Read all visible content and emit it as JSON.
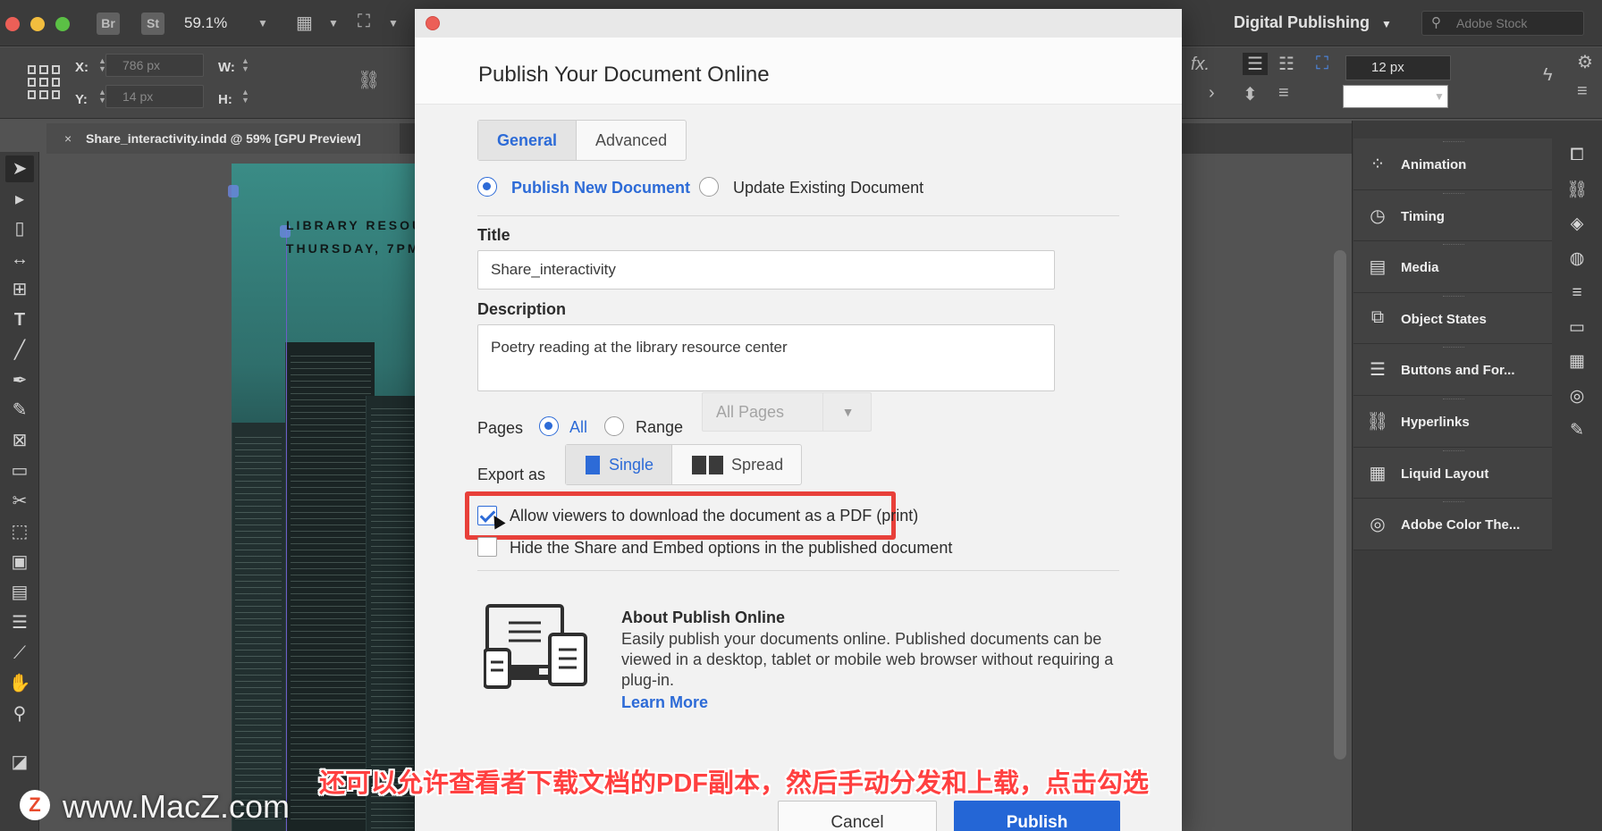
{
  "app": {
    "bridge_label": "Br",
    "stock_label": "St",
    "zoom": "59.1%",
    "workspace": "Digital Publishing",
    "search_placeholder": "Adobe Stock"
  },
  "control_bar": {
    "x_label": "X:",
    "x_value": "786 px",
    "y_label": "Y:",
    "y_value": "14 px",
    "w_label": "W:",
    "h_label": "H:",
    "stroke_weight": "12 px"
  },
  "document_tab": {
    "title": "Share_interactivity.indd @ 59% [GPU Preview]",
    "close": "×"
  },
  "canvas": {
    "line1": "LIBRARY RESOU",
    "line2": "THURSDAY, 7PM"
  },
  "panels": [
    {
      "label": "Animation",
      "icon": "animation-icon",
      "glyph": "⁘"
    },
    {
      "label": "Timing",
      "icon": "timing-icon",
      "glyph": "◷"
    },
    {
      "label": "Media",
      "icon": "media-icon",
      "glyph": "▤"
    },
    {
      "label": "Object States",
      "icon": "object-states-icon",
      "glyph": "⧉"
    },
    {
      "label": "Buttons and For...",
      "icon": "buttons-forms-icon",
      "glyph": "☰"
    },
    {
      "label": "Hyperlinks",
      "icon": "hyperlinks-icon",
      "glyph": "⛓"
    },
    {
      "label": "Liquid Layout",
      "icon": "liquid-layout-icon",
      "glyph": "▦"
    },
    {
      "label": "Adobe Color The...",
      "icon": "adobe-color-themes-icon",
      "glyph": "◎"
    }
  ],
  "dialog": {
    "title": "Publish Your Document Online",
    "tabs": [
      "General",
      "Advanced"
    ],
    "publish_new": "Publish New Document",
    "update_existing": "Update Existing Document",
    "title_label": "Title",
    "title_value": "Share_interactivity",
    "description_label": "Description",
    "description_value": "Poetry reading at the library resource center",
    "pages_label": "Pages",
    "pages_all": "All",
    "pages_range": "Range",
    "pages_dropdown": "All Pages",
    "export_label": "Export as",
    "export_single": "Single",
    "export_spread": "Spread",
    "allow_pdf": "Allow viewers to download the document as a PDF (print)",
    "hide_share": "Hide the Share and Embed options in the published document",
    "about_title": "About Publish Online",
    "about_text": "Easily publish your documents online. Published documents can be viewed in a desktop, tablet or mobile web browser without requiring a plug-in.",
    "learn_more": "Learn More",
    "cancel": "Cancel",
    "publish": "Publish"
  },
  "overlay": {
    "subtitle": "还可以允许查看者下载文档的PDF副本，然后手动分发和上载，点击勾选",
    "watermark_logo": "Z",
    "watermark": "www.MacZ.com"
  },
  "colors": {
    "accent": "#2d6bd7",
    "highlight": "#e8403a",
    "publish_button": "#2466d6"
  }
}
